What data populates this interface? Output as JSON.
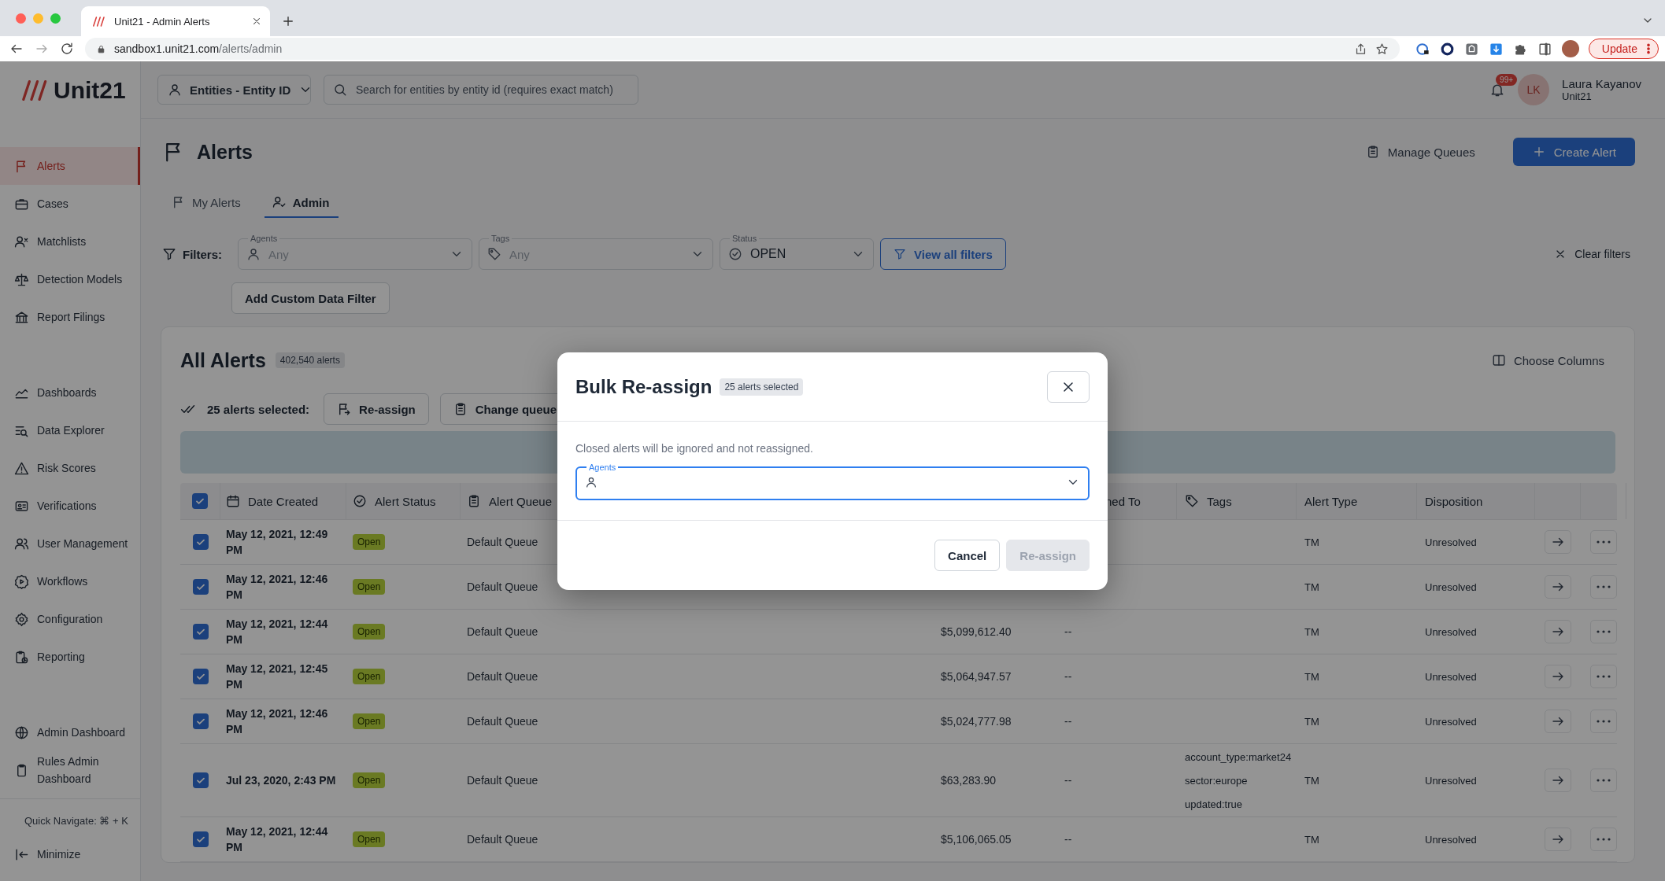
{
  "browser": {
    "tab_title": "Unit21 - Admin Alerts",
    "url_host": "sandbox1.unit21.com",
    "url_path": "/alerts/admin",
    "update_label": "Update"
  },
  "header": {
    "logo": "Unit21",
    "entity_select": "Entities - Entity ID",
    "search_placeholder": "Search for entities by entity id (requires exact match)",
    "notification_count": "99+",
    "avatar_initials": "LK",
    "user_name": "Laura Kayanov",
    "user_org": "Unit21"
  },
  "sidebar": {
    "sections": [
      {
        "items": [
          {
            "label": "Alerts",
            "selected": true
          },
          {
            "label": "Cases",
            "selected": false
          },
          {
            "label": "Matchlists",
            "selected": false
          },
          {
            "label": "Detection Models",
            "selected": false
          },
          {
            "label": "Report Filings",
            "selected": false
          }
        ]
      },
      {
        "items": [
          {
            "label": "Dashboards",
            "selected": false
          },
          {
            "label": "Data Explorer",
            "selected": false
          },
          {
            "label": "Risk Scores",
            "selected": false
          },
          {
            "label": "Verifications",
            "selected": false
          },
          {
            "label": "User Management",
            "selected": false
          },
          {
            "label": "Workflows",
            "selected": false
          },
          {
            "label": "Configuration",
            "selected": false
          },
          {
            "label": "Reporting",
            "selected": false
          }
        ]
      },
      {
        "items": [
          {
            "label": "Admin Dashboard",
            "selected": false
          },
          {
            "label": "Rules Admin Dashboard",
            "selected": false
          }
        ]
      }
    ],
    "quick_navigate": "Quick Navigate: ⌘ + K",
    "minimize": "Minimize"
  },
  "page": {
    "title": "Alerts",
    "manage_queues": "Manage Queues",
    "create_alert": "Create Alert",
    "tabs": [
      {
        "label": "My Alerts",
        "selected": false
      },
      {
        "label": "Admin",
        "selected": true
      }
    ],
    "filters_label": "Filters:",
    "filters": [
      {
        "kind": "agents",
        "label": "Agents",
        "value": "Any"
      },
      {
        "kind": "tags",
        "label": "Tags",
        "value": "Any"
      },
      {
        "kind": "status",
        "label": "Status",
        "value": "OPEN"
      }
    ],
    "view_all_filters": "View all filters",
    "clear_filters": "Clear filters",
    "add_filter": "Add Custom Data Filter"
  },
  "alerts": {
    "title": "All Alerts",
    "count": "402,540 alerts",
    "choose_columns": "Choose Columns",
    "selection": "25 alerts selected:",
    "actions": [
      "Re-assign",
      "Change queue"
    ],
    "table": {
      "all_checked": true,
      "columns": [
        {
          "kind": "date",
          "label": "Date Created"
        },
        {
          "kind": "status",
          "label": "Alert Status"
        },
        {
          "kind": "queue",
          "label": "Alert Queue"
        },
        {
          "kind": "assigned",
          "label": "ned To"
        },
        {
          "kind": "tags",
          "label": "Tags"
        },
        {
          "kind": "type",
          "label": "Alert Type"
        },
        {
          "kind": "disposition",
          "label": "Disposition"
        }
      ],
      "rows": [
        {
          "checked": true,
          "date": "May 12, 2021, 12:49 PM",
          "status": "Open",
          "queue": "Default Queue",
          "type": "TM",
          "disposition": "Unresolved"
        },
        {
          "checked": true,
          "date": "May 12, 2021, 12:46 PM",
          "status": "Open",
          "queue": "Default Queue",
          "type": "TM",
          "disposition": "Unresolved"
        },
        {
          "checked": true,
          "date": "May 12, 2021, 12:44 PM",
          "status": "Open",
          "queue": "Default Queue",
          "amount": "$5,099,612.40",
          "assigned": "--",
          "type": "TM",
          "disposition": "Unresolved"
        },
        {
          "checked": true,
          "date": "May 12, 2021, 12:45 PM",
          "status": "Open",
          "queue": "Default Queue",
          "amount": "$5,064,947.57",
          "assigned": "--",
          "type": "TM",
          "disposition": "Unresolved"
        },
        {
          "checked": true,
          "date": "May 12, 2021, 12:46 PM",
          "status": "Open",
          "queue": "Default Queue",
          "amount": "$5,024,777.98",
          "assigned": "--",
          "type": "TM",
          "disposition": "Unresolved"
        },
        {
          "checked": true,
          "date": "Jul 23, 2020, 2:43 PM",
          "status": "Open",
          "queue": "Default Queue",
          "amount": "$63,283.90",
          "assigned": "--",
          "tags": [
            "account_type:market24",
            "sector:europe",
            "updated:true"
          ],
          "type": "TM",
          "disposition": "Unresolved"
        },
        {
          "checked": true,
          "date": "May 12, 2021, 12:44 PM",
          "status": "Open",
          "queue": "Default Queue",
          "amount": "$5,106,065.05",
          "assigned": "--",
          "type": "TM",
          "disposition": "Unresolved"
        }
      ]
    }
  },
  "modal": {
    "title": "Bulk Re-assign",
    "badge": "25 alerts selected",
    "message": "Closed alerts will be ignored and not reassigned.",
    "field_label": "Agents",
    "focused": true,
    "cancel": "Cancel",
    "confirm": "Re-assign",
    "confirm_disabled": true
  }
}
